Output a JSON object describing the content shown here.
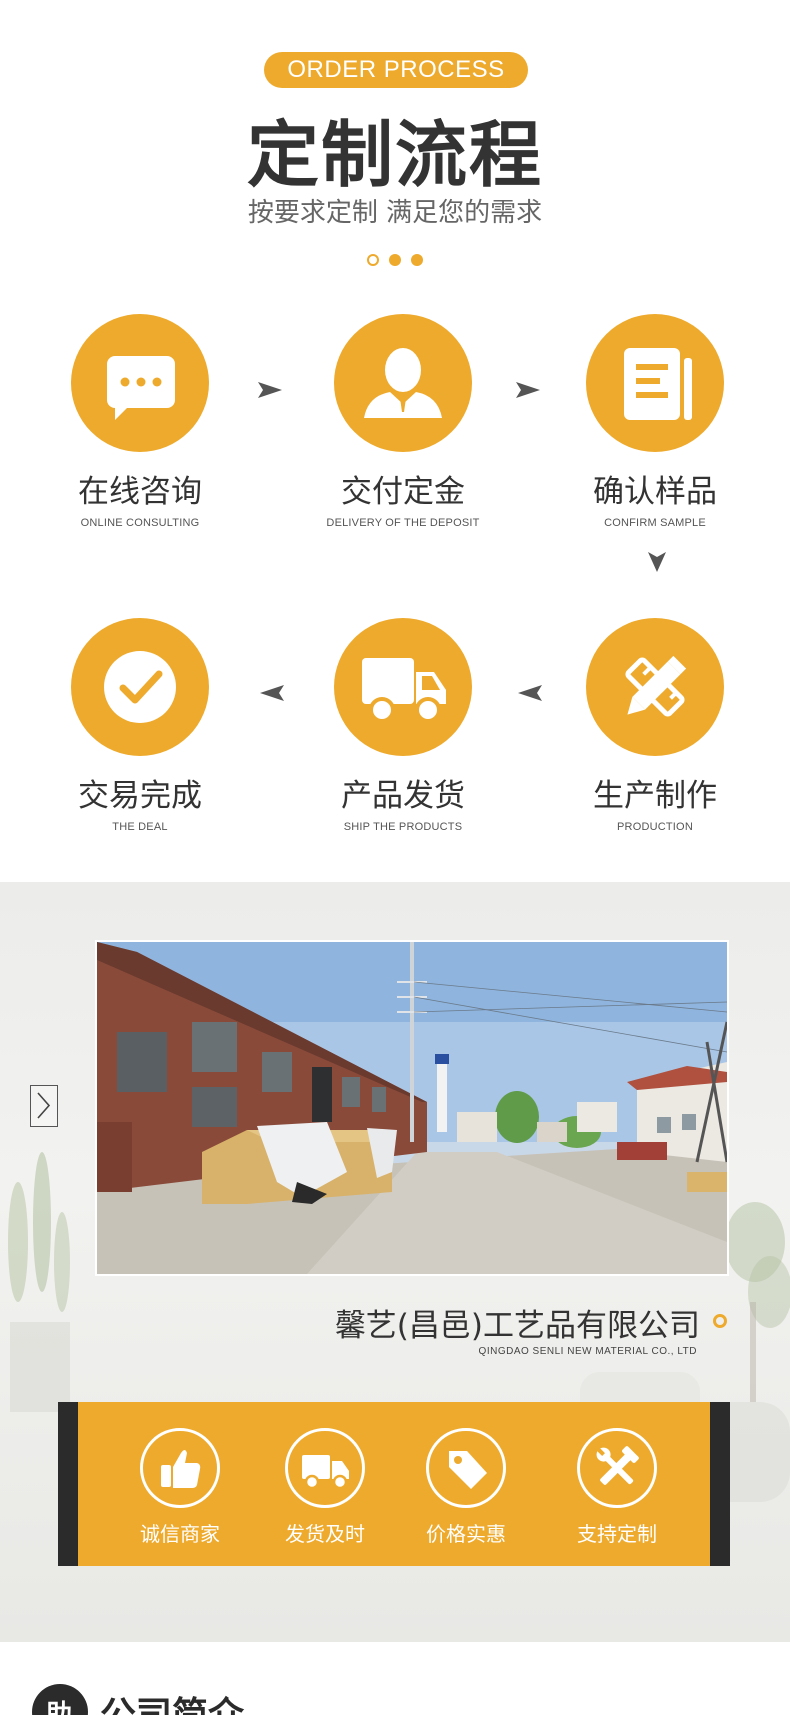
{
  "process": {
    "badge": "ORDER PROCESS",
    "title": "定制流程",
    "subtitle": "按要求定制 满足您的需求",
    "steps": [
      {
        "cn": "在线咨询",
        "en": "ONLINE CONSULTING",
        "icon": "chat-icon"
      },
      {
        "cn": "交付定金",
        "en": "DELIVERY OF THE DEPOSIT",
        "icon": "person-icon"
      },
      {
        "cn": "确认样品",
        "en": "CONFIRM SAMPLE",
        "icon": "document-icon"
      },
      {
        "cn": "交易完成",
        "en": "THE DEAL",
        "icon": "checkmark-icon"
      },
      {
        "cn": "产品发货",
        "en": "SHIP THE PRODUCTS",
        "icon": "truck-icon"
      },
      {
        "cn": "生产制作",
        "en": "PRODUCTION",
        "icon": "pencil-ruler-icon"
      }
    ]
  },
  "company": {
    "name": "馨艺(昌邑)工艺品有限公司",
    "name_en": "QINGDAO SENLI NEW MATERIAL CO., LTD",
    "features": [
      {
        "label": "诚信商家",
        "icon": "thumbs-up-icon"
      },
      {
        "label": "发货及时",
        "icon": "truck-icon"
      },
      {
        "label": "价格实惠",
        "icon": "price-tag-icon"
      },
      {
        "label": "支持定制",
        "icon": "tools-icon"
      }
    ]
  },
  "intro": {
    "icon_glyph": "助",
    "title": "公司简介"
  },
  "colors": {
    "accent": "#eeaa2c",
    "dark": "#2b2b2b"
  }
}
